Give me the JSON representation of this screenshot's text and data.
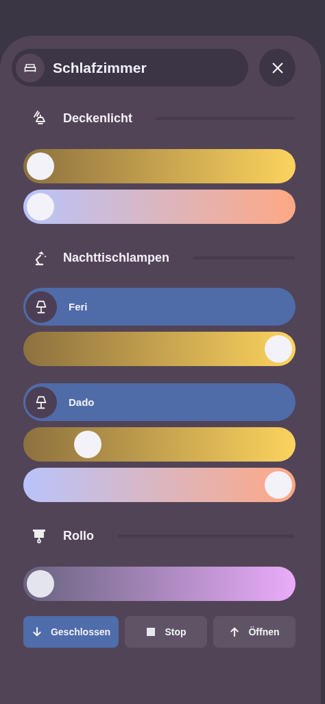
{
  "header": {
    "title": "Schlafzimmer"
  },
  "sections": [
    {
      "title": "Deckenlicht",
      "kind": "ceiling",
      "items": [
        {
          "kind": "brightness",
          "level": 0
        },
        {
          "kind": "temperature",
          "level": 0
        }
      ]
    },
    {
      "title": "Nachttischlampen",
      "kind": "desk",
      "items": [
        {
          "kind": "switch",
          "name": "Feri",
          "on": true
        },
        {
          "kind": "brightness",
          "level": 1
        },
        {
          "kind": "switch",
          "name": "Dado",
          "on": true
        },
        {
          "kind": "brightness",
          "level": 0.2
        },
        {
          "kind": "temperature",
          "level": 1
        }
      ]
    },
    {
      "title": "Rollo",
      "kind": "blind",
      "items": [
        {
          "kind": "position",
          "level": 0
        }
      ]
    }
  ],
  "buttons": [
    {
      "label": "Geschlossen",
      "kind": "down",
      "selected": true
    },
    {
      "label": "Stop",
      "kind": "stop",
      "selected": false
    },
    {
      "label": "Öffnen",
      "kind": "up",
      "selected": false
    }
  ]
}
